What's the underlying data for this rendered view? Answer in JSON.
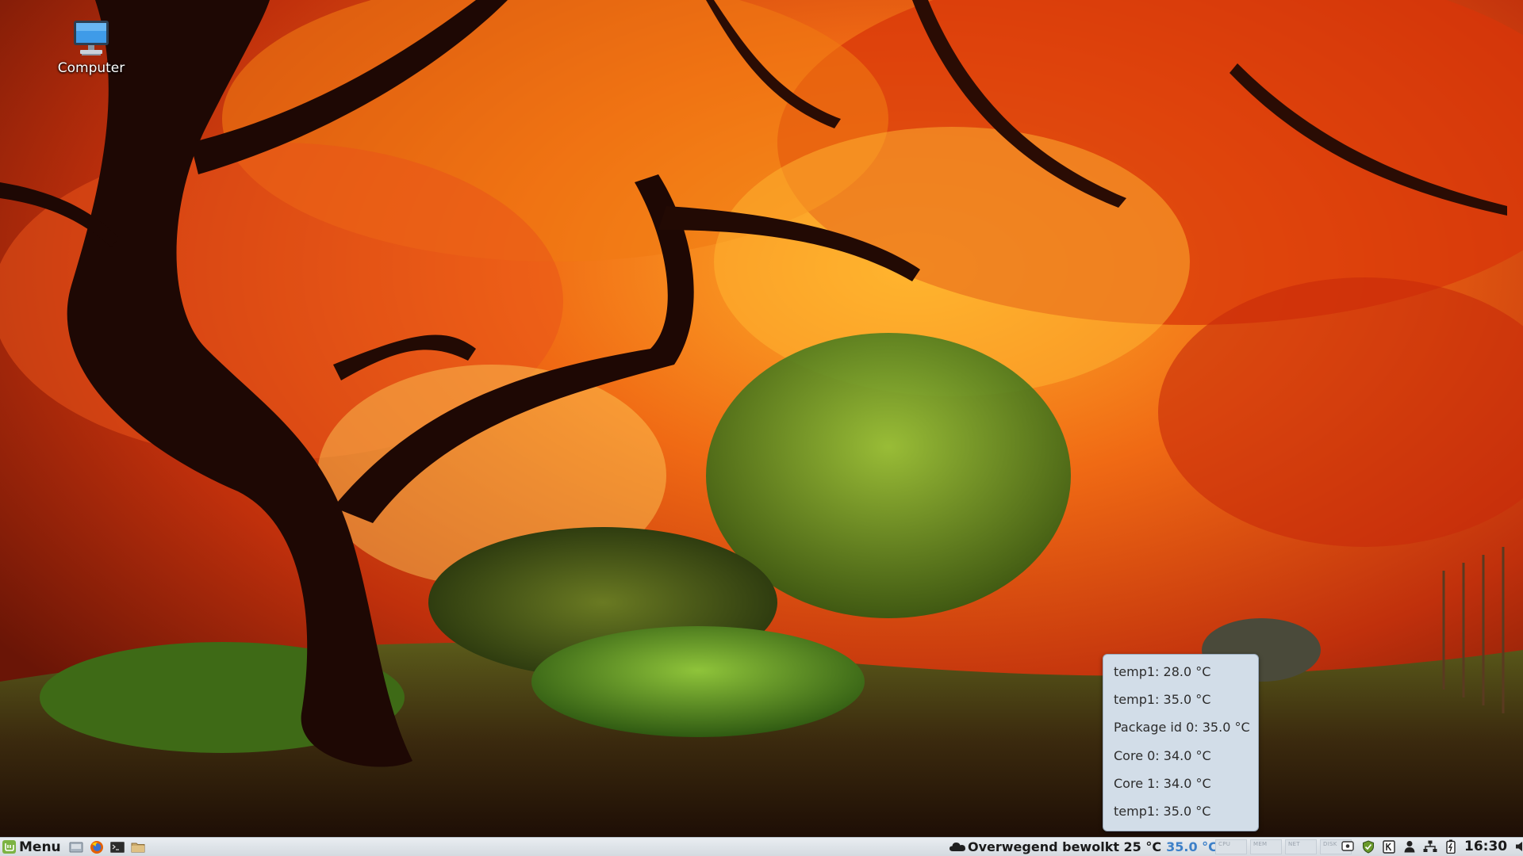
{
  "desktop": {
    "icons": [
      {
        "label": "Computer"
      }
    ]
  },
  "sensor_popup": {
    "rows": [
      "temp1: 28.0 °C",
      "temp1: 35.0 °C",
      "Package id 0: 35.0 °C",
      "Core 0: 34.0 °C",
      "Core 1: 34.0 °C",
      "temp1: 35.0 °C"
    ]
  },
  "panel": {
    "menu_label": "Menu",
    "launchers": [
      "show-desktop-icon",
      "firefox-icon",
      "terminal-icon",
      "files-icon"
    ],
    "weather": {
      "text": "Overwegend bewolkt 25 °C",
      "sensor_temp": "35.0 °C"
    },
    "graphs": [
      "CPU",
      "MEM",
      "NET",
      "DISK"
    ],
    "tray": [
      "screen-icon",
      "shield-check-icon",
      "keyboard-icon",
      "user-icon",
      "network-icon",
      "battery-icon"
    ],
    "clock": "16:30",
    "volume_icon": "volume-icon"
  },
  "colors": {
    "panel_bg": "#e3e8ed",
    "accent_blue": "#3d80c8",
    "popup_bg": "#d2dde8"
  }
}
